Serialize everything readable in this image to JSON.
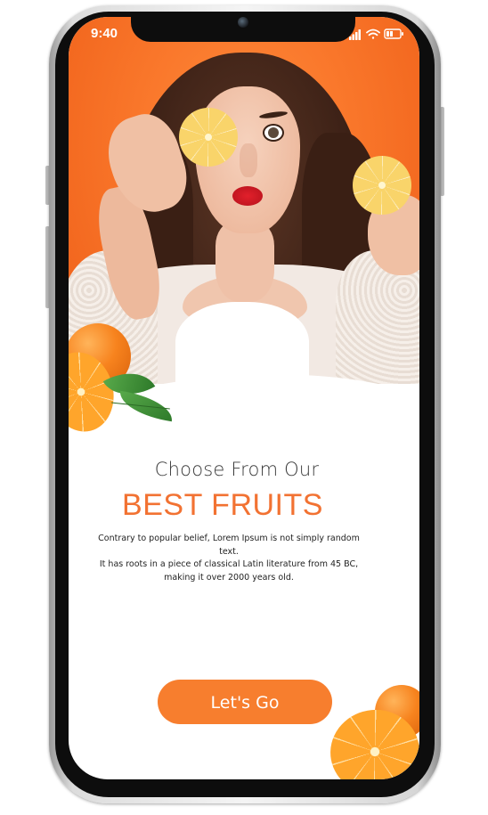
{
  "status_bar": {
    "time": "9:40",
    "icons": [
      "signal-icon",
      "wifi-icon",
      "battery-icon"
    ]
  },
  "content": {
    "subtitle": "Choose From Our",
    "title": "BEST FRUITS",
    "description": [
      "Contrary to popular belief, Lorem Ipsum is not simply random text.",
      "It has roots in a piece of classical Latin literature from 45 BC,",
      "making it over 2000 years old."
    ]
  },
  "cta": {
    "label": "Let's Go"
  },
  "colors": {
    "accent": "#f27232",
    "button": "#f77e2e",
    "hero_bg": "#f9762a",
    "text": "#222222"
  }
}
